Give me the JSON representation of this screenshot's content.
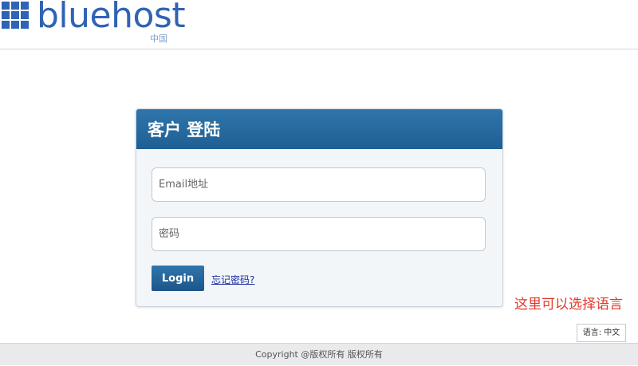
{
  "header": {
    "logo_text": "bluehost",
    "logo_sub": "中国"
  },
  "login": {
    "title": "客户 登陆",
    "email_placeholder": "Email地址",
    "password_placeholder": "密码",
    "login_label": "Login",
    "forgot_label": "忘记密码?"
  },
  "annotation": {
    "note": "这里可以选择语言"
  },
  "language": {
    "label": "语言: 中文"
  },
  "footer": {
    "copyright": "Copyright @版权所有 版权所有"
  },
  "colors": {
    "brand_blue": "#2f63b4",
    "panel_header": "#1f5f93",
    "note_red": "#e0392b"
  }
}
